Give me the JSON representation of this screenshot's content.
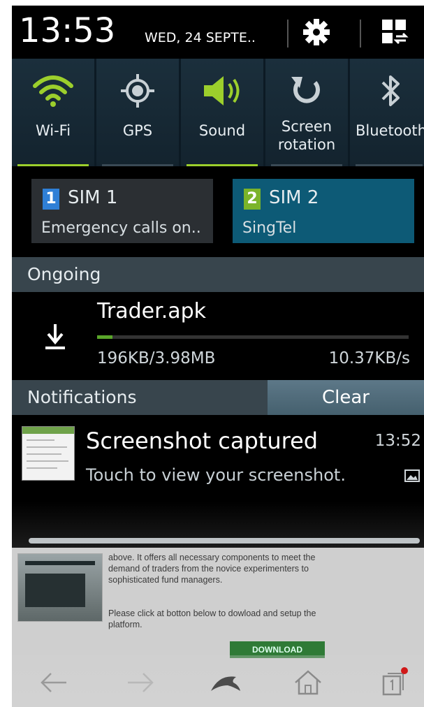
{
  "status": {
    "time": "13:53",
    "date": "WED, 24 SEPTE.."
  },
  "colors": {
    "accent_green": "#9ccf2c",
    "sim2_teal": "#0d5a76",
    "section_bar": "#38454d",
    "progress_green": "#5aa62a"
  },
  "toggles": [
    {
      "label": "Wi-Fi",
      "icon": "wifi-icon",
      "active": true
    },
    {
      "label": "GPS",
      "icon": "gps-icon",
      "active": false
    },
    {
      "label": "Sound",
      "icon": "sound-icon",
      "active": true
    },
    {
      "label_line1": "Screen",
      "label_line2": "rotation",
      "icon": "rotation-icon",
      "active": false
    },
    {
      "label": "Bluetooth",
      "icon": "bluetooth-icon",
      "active": false
    }
  ],
  "sims": [
    {
      "badge": "1",
      "name": "SIM 1",
      "status": "Emergency calls on..",
      "badge_color": "#2f7fd6"
    },
    {
      "badge": "2",
      "name": "SIM 2",
      "status": "SingTel",
      "badge_color": "#7bb42a"
    }
  ],
  "ongoing": {
    "section_title": "Ongoing",
    "title": "Trader.apk",
    "size": "196KB/3.98MB",
    "speed": "10.37KB/s",
    "progress_fraction": 0.049
  },
  "notifications": {
    "section_title": "Notifications",
    "clear_label": "Clear",
    "items": [
      {
        "title": "Screenshot captured",
        "time": "13:52",
        "subtitle": "Touch to view your screenshot."
      }
    ]
  },
  "webpage": {
    "para1": "above. It offers all necessary components to meet the demand of traders from the novice experimenters to sophisticated fund managers.",
    "para2": "Please click at botton below to dowload and setup the platform.",
    "download_label": "DOWNLOAD"
  }
}
